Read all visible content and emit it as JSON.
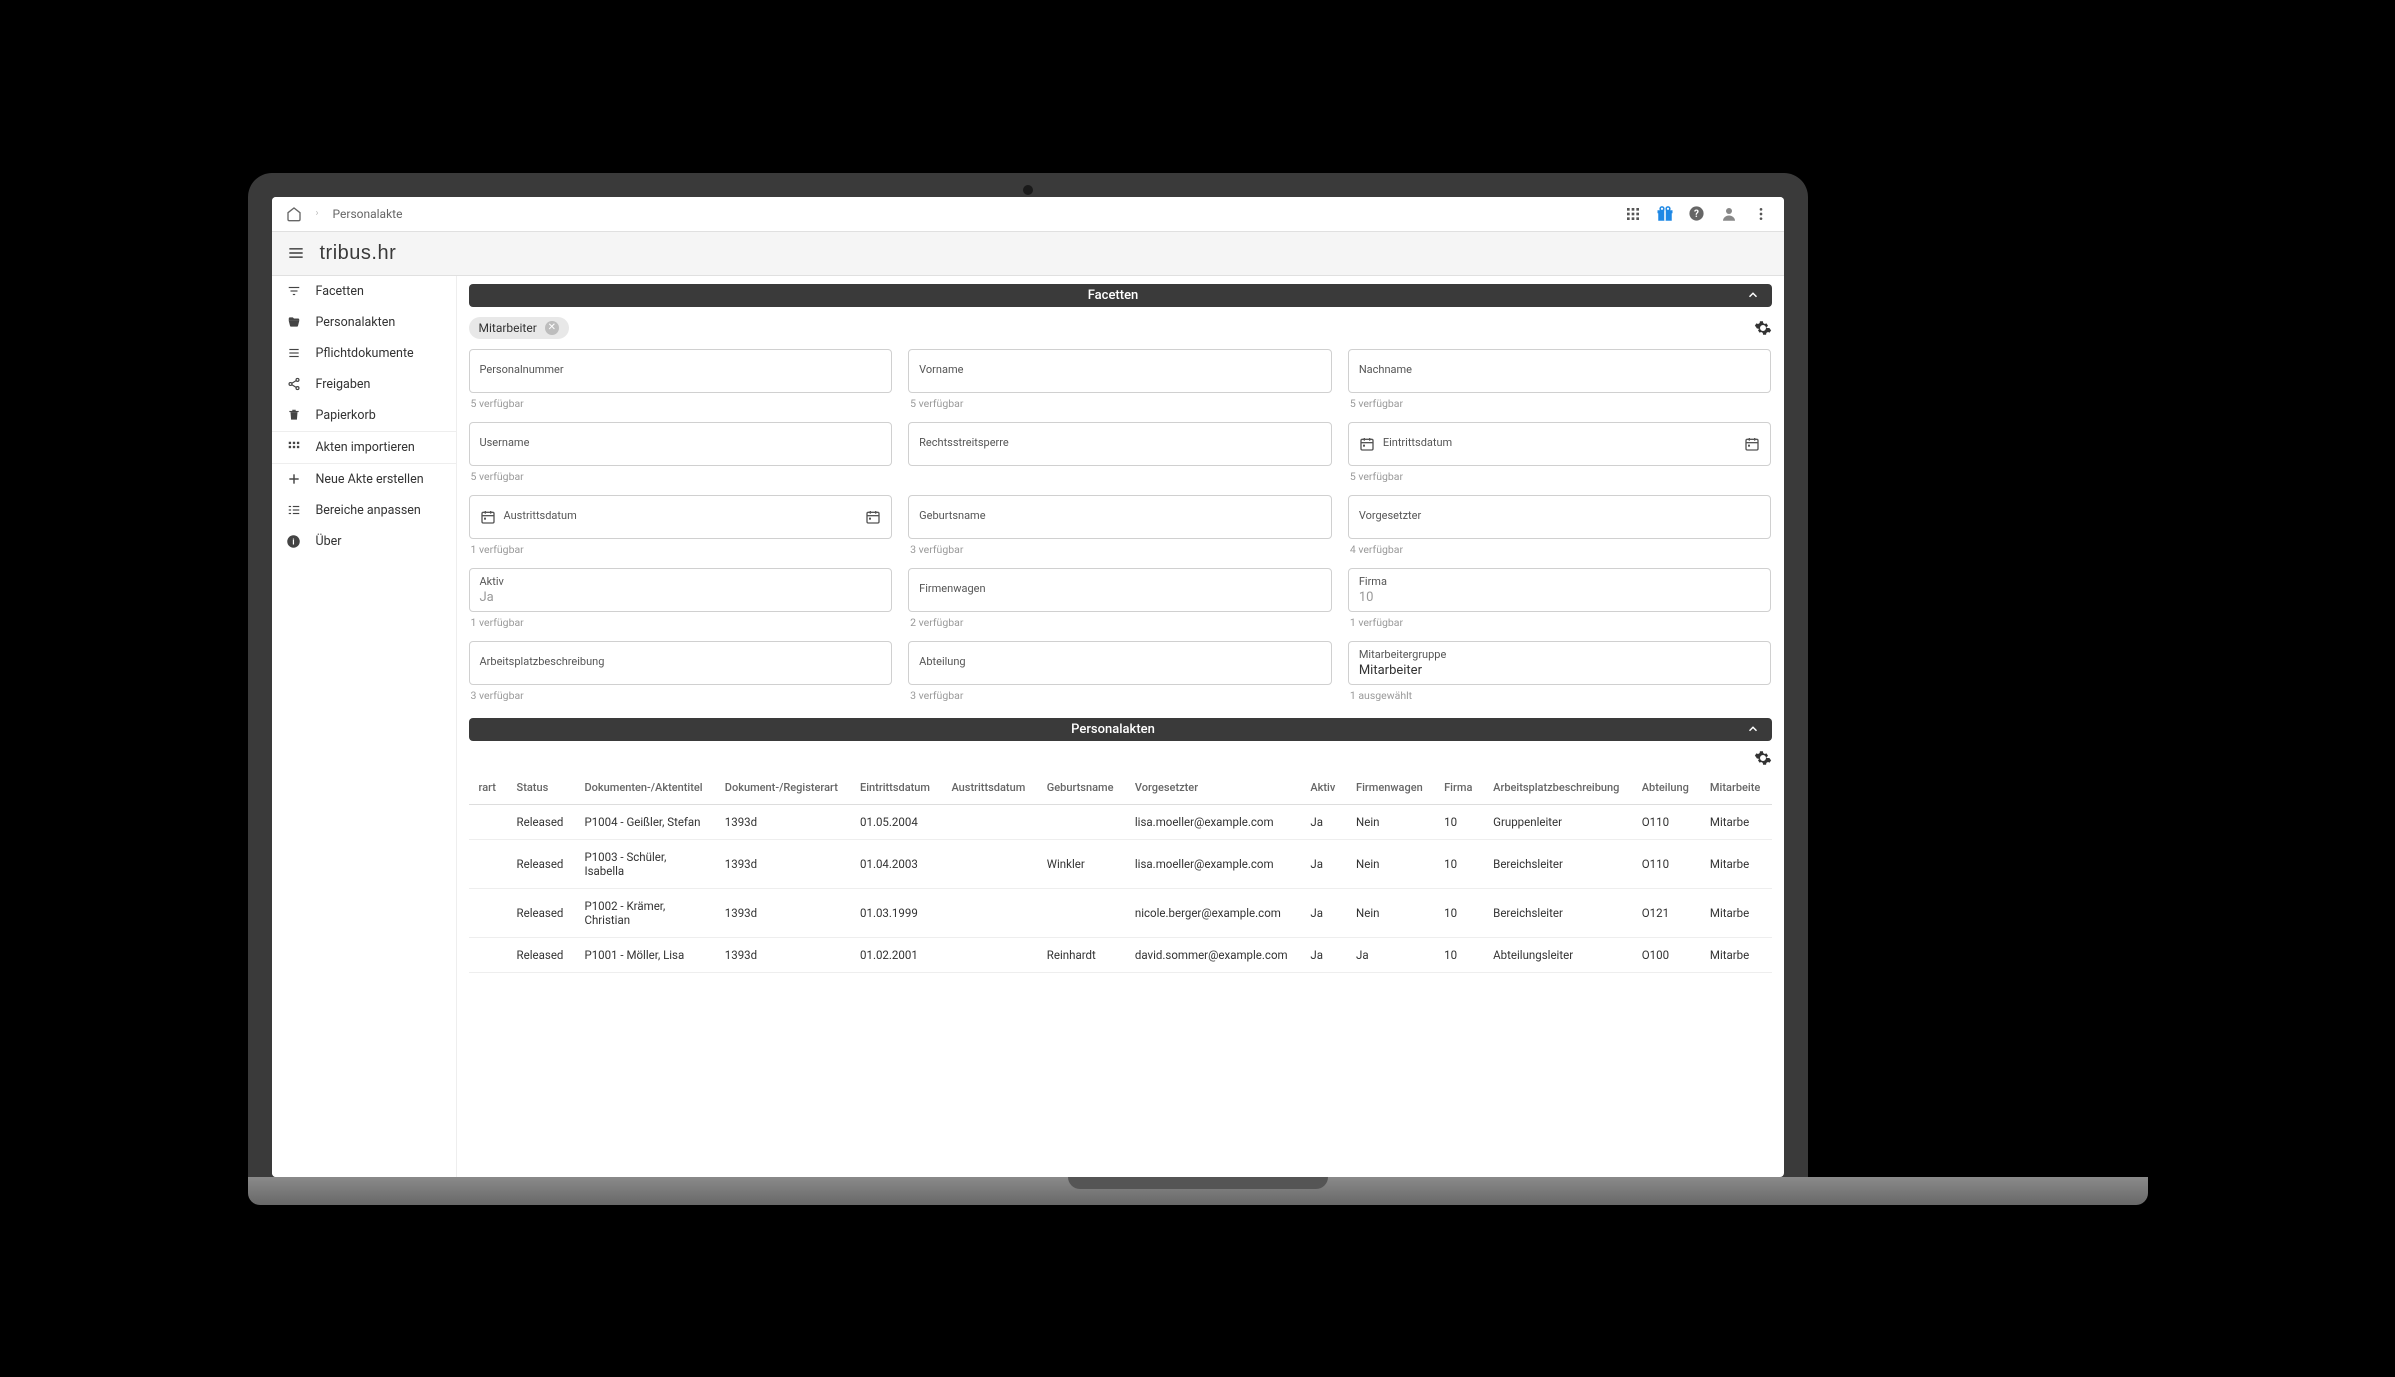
{
  "breadcrumb": {
    "page": "Personalakte"
  },
  "logo": {
    "brand": "tribus.",
    "suffix": "hr"
  },
  "sidebar": {
    "items": [
      {
        "label": "Facetten",
        "icon": "filter"
      },
      {
        "label": "Personalakten",
        "icon": "folder-open"
      },
      {
        "label": "Pflichtdokumente",
        "icon": "list"
      },
      {
        "label": "Freigaben",
        "icon": "share"
      },
      {
        "label": "Papierkorb",
        "icon": "trash"
      },
      {
        "label": "Akten importieren",
        "icon": "grid"
      },
      {
        "label": "Neue Akte erstellen",
        "icon": "plus"
      },
      {
        "label": "Bereiche anpassen",
        "icon": "columns"
      },
      {
        "label": "Über",
        "icon": "info"
      }
    ]
  },
  "sections": {
    "facetten_title": "Facetten",
    "personalakten_title": "Personalakten"
  },
  "chip": {
    "label": "Mitarbeiter"
  },
  "facets": [
    {
      "label": "Personalnummer",
      "value": "",
      "hint": "5 verfügbar",
      "icon": null
    },
    {
      "label": "Vorname",
      "value": "",
      "hint": "5 verfügbar",
      "icon": null
    },
    {
      "label": "Nachname",
      "value": "",
      "hint": "5 verfügbar",
      "icon": null
    },
    {
      "label": "Username",
      "value": "",
      "hint": "5 verfügbar",
      "icon": null
    },
    {
      "label": "Rechtsstreitsperre",
      "value": "",
      "hint": "",
      "icon": null
    },
    {
      "label": "Eintrittsdatum",
      "value": "",
      "hint": "5 verfügbar",
      "icon": "calendar-left"
    },
    {
      "label": "Austrittsdatum",
      "value": "",
      "hint": "1 verfügbar",
      "icon": "calendar-right"
    },
    {
      "label": "Geburtsname",
      "value": "",
      "hint": "3 verfügbar",
      "icon": null
    },
    {
      "label": "Vorgesetzter",
      "value": "",
      "hint": "4 verfügbar",
      "icon": null
    },
    {
      "label": "Aktiv",
      "value": "Ja",
      "hint": "1 verfügbar",
      "icon": null,
      "placeholder": true
    },
    {
      "label": "Firmenwagen",
      "value": "",
      "hint": "2 verfügbar",
      "icon": null
    },
    {
      "label": "Firma",
      "value": "10",
      "hint": "1 verfügbar",
      "icon": null,
      "placeholder": true
    },
    {
      "label": "Arbeitsplatzbeschreibung",
      "value": "",
      "hint": "3 verfügbar",
      "icon": null
    },
    {
      "label": "Abteilung",
      "value": "",
      "hint": "3 verfügbar",
      "icon": null
    },
    {
      "label": "Mitarbeitergruppe",
      "value": "Mitarbeiter",
      "hint": "1 ausgewählt",
      "icon": null,
      "filled": true
    }
  ],
  "table": {
    "headers": [
      "rart",
      "Status",
      "Dokumenten-/Aktentitel",
      "Dokument-/Registerart",
      "Eintrittsdatum",
      "Austrittsdatum",
      "Geburtsname",
      "Vorgesetzter",
      "Aktiv",
      "Firmenwagen",
      "Firma",
      "Arbeitsplatzbeschreibung",
      "Abteilung",
      "Mitarbeite"
    ],
    "rows": [
      [
        "",
        "Released",
        "P1004 - Geißler, Stefan",
        "1393d",
        "01.05.2004",
        "",
        "",
        "lisa.moeller@example.com",
        "Ja",
        "Nein",
        "10",
        "Gruppenleiter",
        "O110",
        "Mitarbe"
      ],
      [
        "",
        "Released",
        "P1003 - Schüler, Isabella",
        "1393d",
        "01.04.2003",
        "",
        "Winkler",
        "lisa.moeller@example.com",
        "Ja",
        "Nein",
        "10",
        "Bereichsleiter",
        "O110",
        "Mitarbe"
      ],
      [
        "",
        "Released",
        "P1002 - Krämer, Christian",
        "1393d",
        "01.03.1999",
        "",
        "",
        "nicole.berger@example.com",
        "Ja",
        "Nein",
        "10",
        "Bereichsleiter",
        "O121",
        "Mitarbe"
      ],
      [
        "",
        "Released",
        "P1001 - Möller, Lisa",
        "1393d",
        "01.02.2001",
        "",
        "Reinhardt",
        "david.sommer@example.com",
        "Ja",
        "Ja",
        "10",
        "Abteilungsleiter",
        "O100",
        "Mitarbe"
      ]
    ]
  }
}
